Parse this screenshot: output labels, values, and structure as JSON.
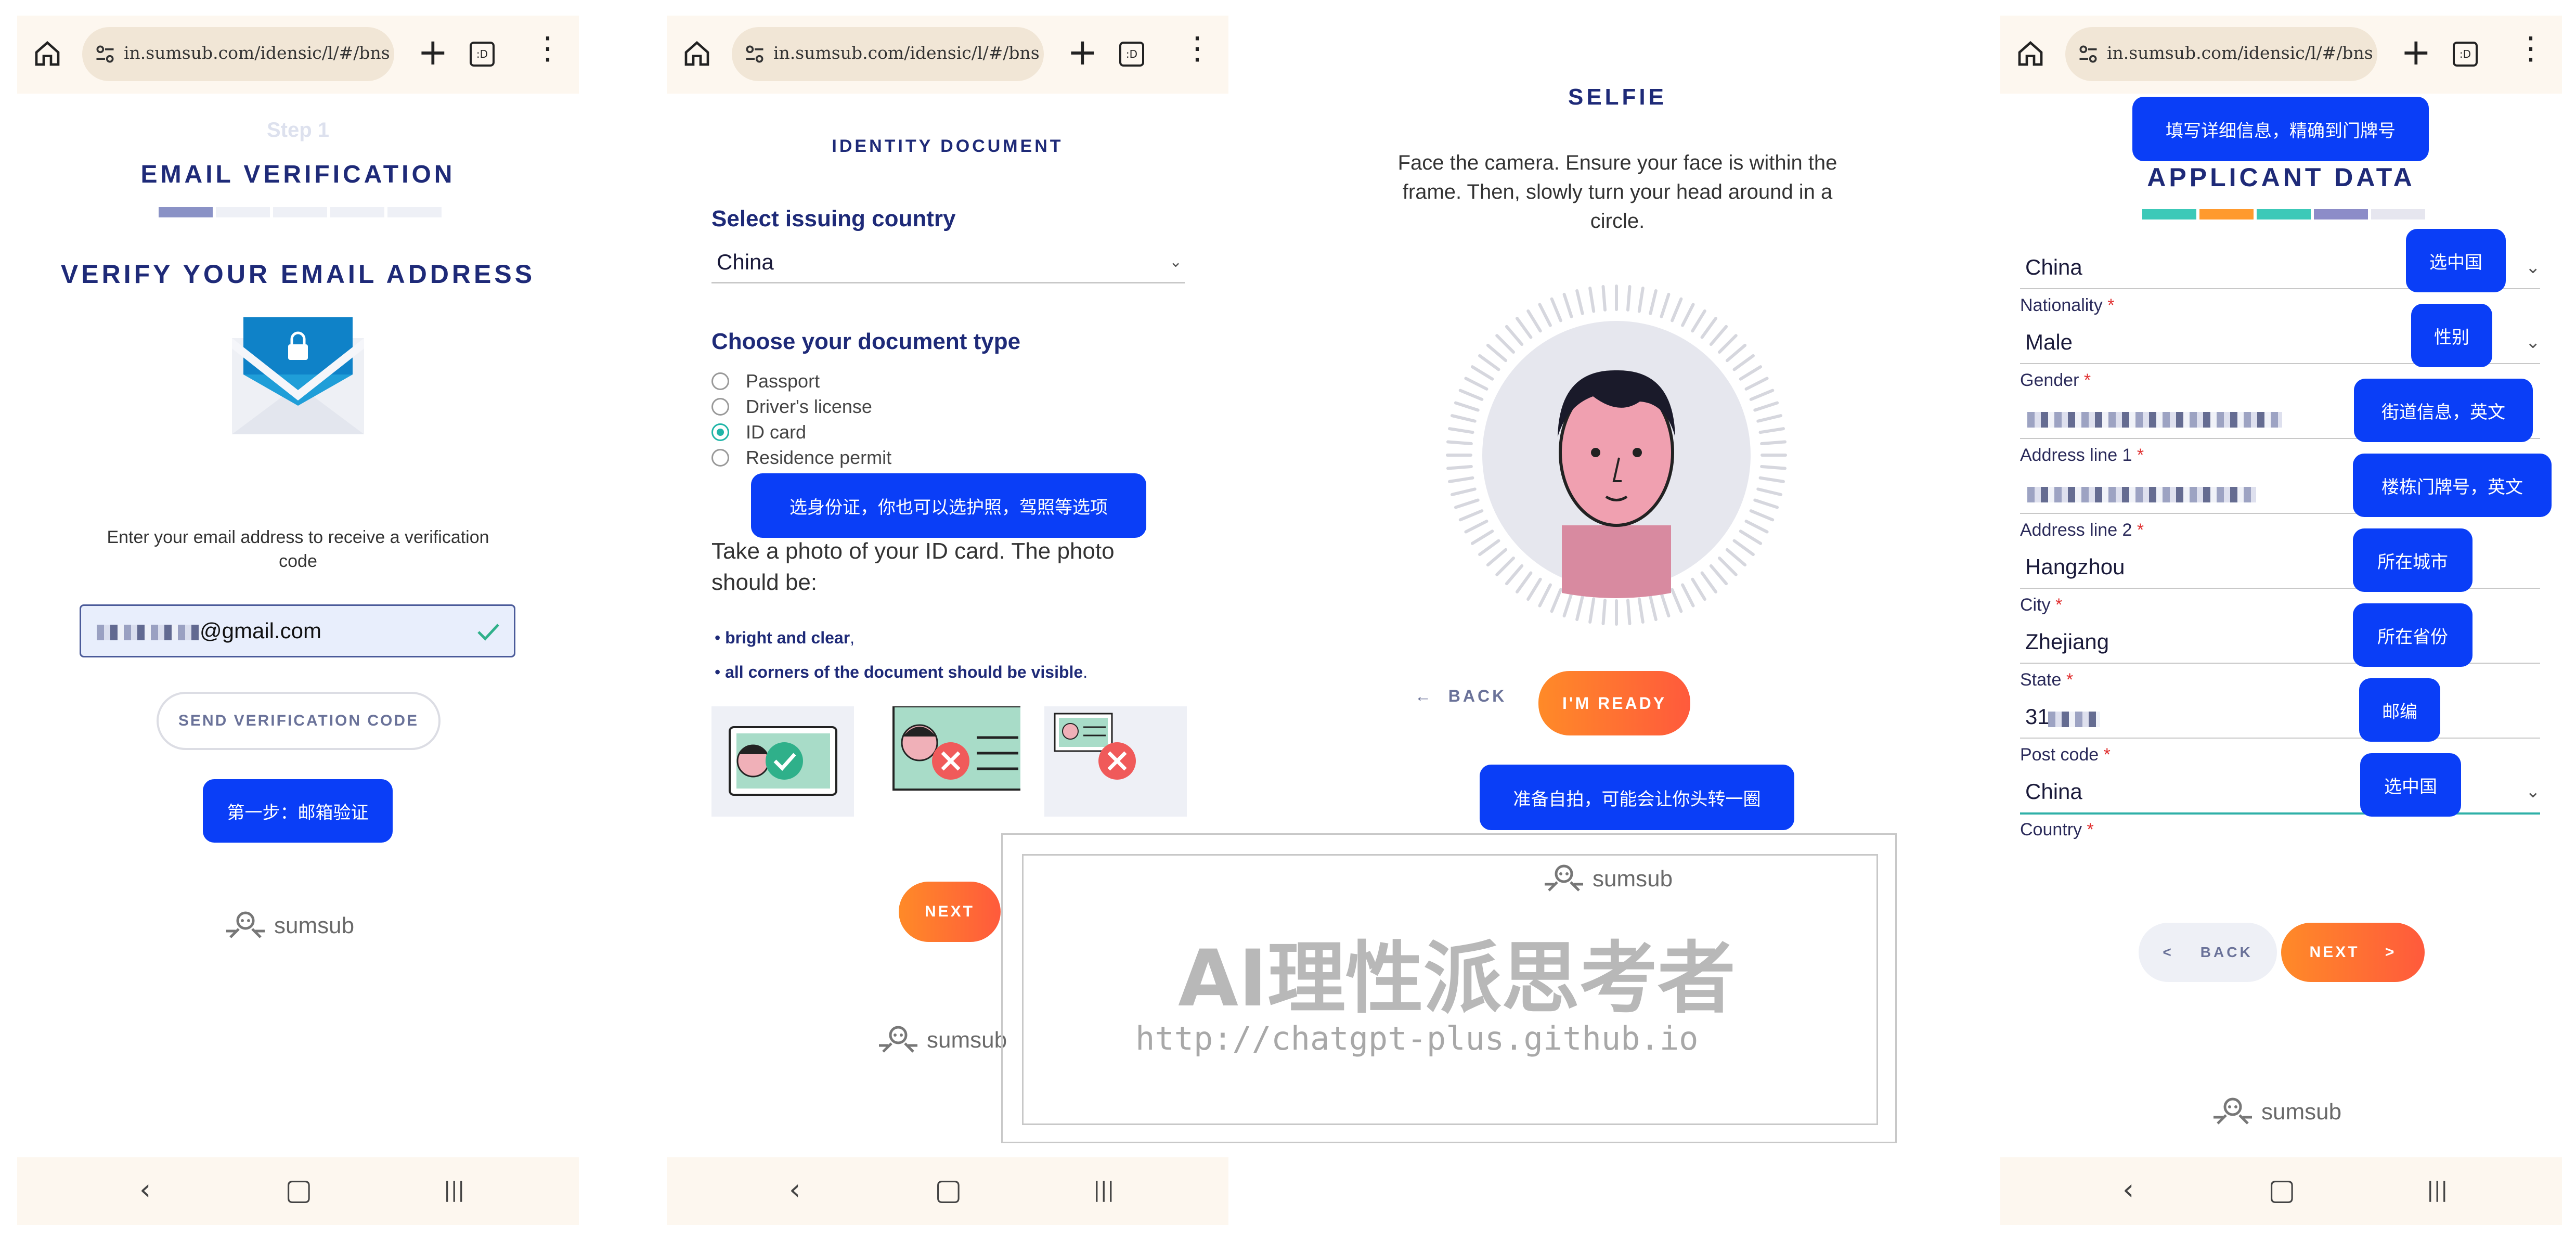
{
  "browser": {
    "url": "in.sumsub.com/idensic/l/#/bnsv\\",
    "tabs_glyph": ":D"
  },
  "nav": {
    "back": "‹",
    "home": "▢",
    "recents": "|||"
  },
  "panel1": {
    "step": "Step 1",
    "title": "EMAIL VERIFICATION",
    "heading": "VERIFY YOUR EMAIL ADDRESS",
    "instruction": "Enter your email address to receive a verification code",
    "email_suffix": "@gmail.com",
    "send_button": "SEND VERIFICATION CODE",
    "note": "第一步：邮箱验证",
    "brand": "sumsub"
  },
  "panel2": {
    "title": "IDENTITY DOCUMENT",
    "country_label": "Select issuing country",
    "country_value": "China",
    "doctype_label": "Choose your document type",
    "doc_types": [
      "Passport",
      "Driver's license",
      "ID card",
      "Residence permit"
    ],
    "selected_doc_type": "ID card",
    "note": "选身份证，你也可以选护照，驾照等选项",
    "photo_instruction": "Take a photo of your ID card. The photo should be:",
    "bullet1_bold": "bright and clear",
    "bullet1_tail": ",",
    "bullet2_bold": "all corners of the document should be visible",
    "bullet2_tail": ".",
    "next_button": "NEXT",
    "brand": "sumsub"
  },
  "panel3": {
    "title": "SELFIE",
    "instruction": "Face the camera. Ensure your face is within the frame. Then, slowly turn your head around in a circle.",
    "back_button": "BACK",
    "ready_button": "I'M READY",
    "note": "准备自拍，可能会让你头转一圈",
    "brand": "sumsub"
  },
  "watermark": {
    "title": "AI理性派思考者",
    "url": "http://chatgpt-plus.github.io"
  },
  "panel4": {
    "top_note": "填写详细信息，精确到门牌号",
    "title": "APPLICANT DATA",
    "progress_colors": [
      "#3cc9b8",
      "#ff9a2e",
      "#3cc9b8",
      "#8c8cc8",
      "#e6e6ef"
    ],
    "fields": [
      {
        "value": "China",
        "label": "Nationality",
        "note": "选中国"
      },
      {
        "value": "Male",
        "label": "Gender",
        "note": "性别"
      },
      {
        "value": "",
        "label": "Address line 1",
        "note": "街道信息，英文"
      },
      {
        "value": "",
        "label": "Address line 2",
        "note": "楼栋门牌号，英文"
      },
      {
        "value": "Hangzhou",
        "label": "City",
        "note": "所在城市"
      },
      {
        "value": "Zhejiang",
        "label": "State",
        "note": "所在省份"
      },
      {
        "value": "31",
        "label": "Post code",
        "note": "邮编"
      },
      {
        "value": "China",
        "label": "Country",
        "note": "选中国"
      }
    ],
    "back_button": "BACK",
    "next_button": "NEXT",
    "back_prefix": "<",
    "next_suffix": ">",
    "brand": "sumsub"
  }
}
